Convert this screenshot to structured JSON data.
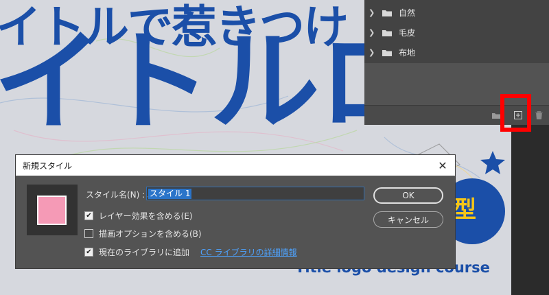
{
  "canvas": {
    "line1": "イトルで惹きつけ",
    "line2": "イトルロ",
    "line3": "Title logo design course",
    "badge": "型"
  },
  "libraries": {
    "items": [
      {
        "label": "自然",
        "icon": "folder-icon"
      },
      {
        "label": "毛皮",
        "icon": "folder-icon"
      },
      {
        "label": "布地",
        "icon": "folder-icon"
      }
    ],
    "footer_icons": [
      "folder-icon",
      "new-item-icon",
      "trash-icon"
    ]
  },
  "dialog": {
    "title": "新規スタイル",
    "close_icon": "✕",
    "name_label": "スタイル名(N) :",
    "name_value": "スタイル 1",
    "swatch_color": "#f59ab6",
    "options": [
      {
        "label": "レイヤー効果を含める(E)",
        "checked": true
      },
      {
        "label": "描画オプションを含める(B)",
        "checked": false
      },
      {
        "label": "現在のライブラリに追加",
        "checked": true
      }
    ],
    "link_label": "CC ライブラリの詳細情報",
    "ok_label": "OK",
    "cancel_label": "キャンセル"
  },
  "colors": {
    "highlight": "#ff0000",
    "link": "#4ea3ff",
    "art_blue": "#1b4fa8"
  }
}
